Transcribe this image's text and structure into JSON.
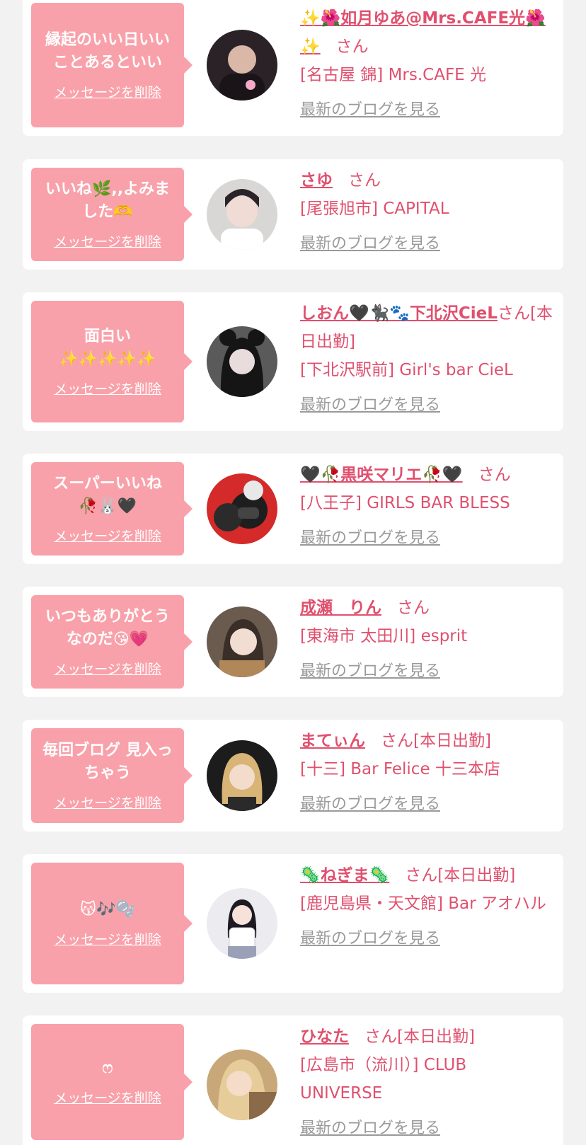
{
  "delete_label": "メッセージを削除",
  "blog_label": "最新のブログを見る",
  "suffix": "さん",
  "colors": {
    "bubble": "#f9a1aa",
    "accent": "#e0506e",
    "muted": "#9a9a9a",
    "background": "#f2f2f2"
  },
  "items": [
    {
      "message": "縁起のいい日いいことあるといい",
      "name": "✨🌺如月ゆあ@Mrs.CAFE光🌺✨",
      "status": "",
      "shop": "[名古屋 錦] Mrs.CAFE 光",
      "avatar_color": "#2a2226"
    },
    {
      "message": "いいね🌿,,よみました🫶",
      "name": "さゆ",
      "status": "",
      "shop": "[尾張旭市] CAPITAL",
      "avatar_color": "#d9d6d6"
    },
    {
      "message": "面白い\n✨✨✨✨✨",
      "name": "しおん🖤🐈‍⬛🐾下北沢CieL",
      "status": "[本日出勤]",
      "shop": "[下北沢駅前] Girl's bar CieL",
      "avatar_color": "#3a3a3a"
    },
    {
      "message": "スーパーいいね\n🥀🐰🖤",
      "name": "🖤🥀黒咲マリエ🥀🖤",
      "status": "",
      "shop": "[八王子] GIRLS BAR BLESS",
      "avatar_color": "#d42a2a"
    },
    {
      "message": "いつもありがとうなのだ😘💗",
      "name": "成瀬　りん",
      "status": "",
      "shop": "[東海市 太田川] esprit",
      "avatar_color": "#6b5a4e"
    },
    {
      "message": "毎回ブログ 見入っちゃう",
      "name": "まてぃん",
      "status": "[本日出勤]",
      "shop": "[十三] Bar Felice 十三本店",
      "avatar_color": "#c9a66b"
    },
    {
      "message": "😽🎶🫧",
      "name": "🦠ねぎま🦠",
      "status": "[本日出勤]",
      "shop": "[鹿児島県・天文館] Bar アオハル",
      "avatar_color": "#e8e6ee"
    },
    {
      "message": "ෆ",
      "name": "ひなた",
      "status": "[本日出勤]",
      "shop": "[広島市（流川）] CLUB UNIVERSE",
      "avatar_color": "#c8a878"
    }
  ]
}
